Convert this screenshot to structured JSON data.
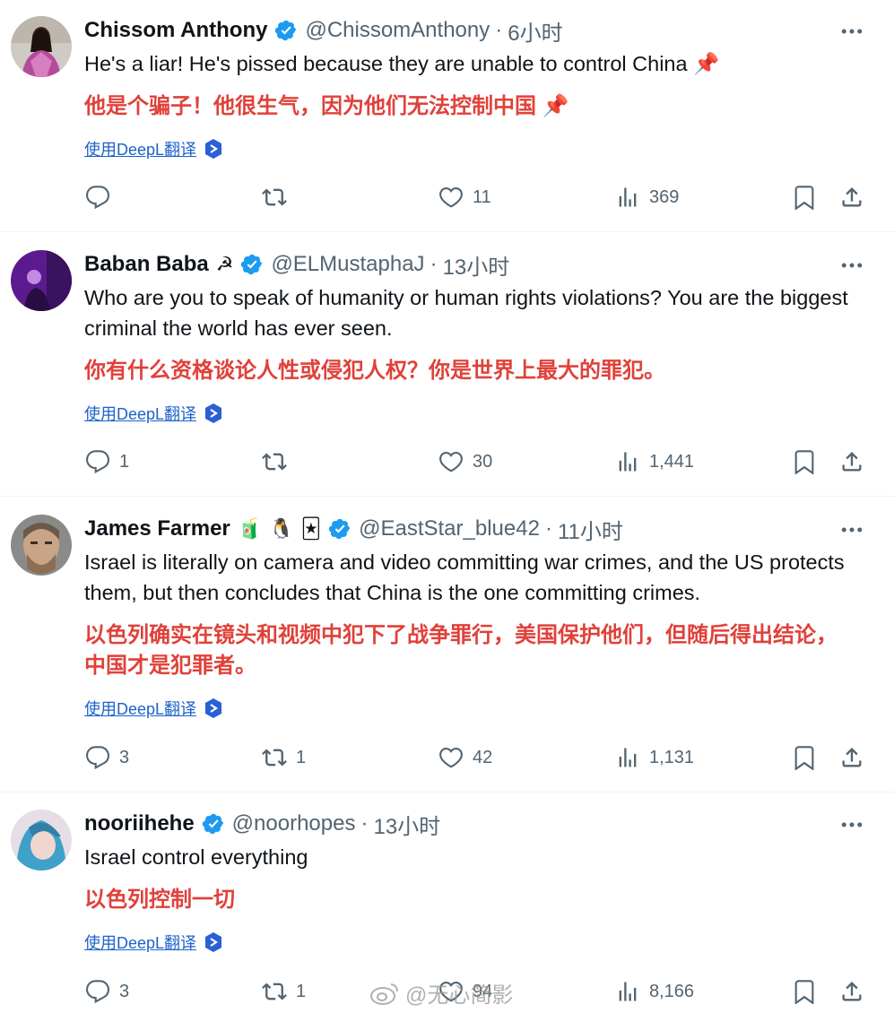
{
  "tweets": [
    {
      "name": "Chissom Anthony",
      "handle": "@ChissomAnthony",
      "dot": "·",
      "time": "6小时",
      "emojis": [],
      "text": "He's a liar! He's pissed because they are unable to control China 📌",
      "translation": "他是个骗子！他很生气，因为他们无法控制中国 📌",
      "translate_label": "使用DeepL翻译",
      "replies": "",
      "reposts": "",
      "likes": "11",
      "views": "369"
    },
    {
      "name": "Baban Baba",
      "handle": "@ELMustaphaJ",
      "dot": "·",
      "time": "13小时",
      "emojis": [
        "☭"
      ],
      "text": "Who are you to speak of humanity or human rights violations? You are the biggest criminal the world has ever seen.",
      "translation": "你有什么资格谈论人性或侵犯人权？你是世界上最大的罪犯。",
      "translate_label": "使用DeepL翻译",
      "replies": "1",
      "reposts": "",
      "likes": "30",
      "views": "1,441"
    },
    {
      "name": "James Farmer",
      "handle": "@EastStar_blue42",
      "dot": "·",
      "time": "11小时",
      "emojis": [
        "🧃",
        "🐧",
        "🃏"
      ],
      "text": "Israel is literally on camera and video committing war crimes, and the US protects them, but then concludes that China is the one committing crimes.",
      "translation": "以色列确实在镜头和视频中犯下了战争罪行，美国保护他们，但随后得出结论，中国才是犯罪者。",
      "translate_label": "使用DeepL翻译",
      "replies": "3",
      "reposts": "1",
      "likes": "42",
      "views": "1,131"
    },
    {
      "name": "nooriihehe",
      "handle": "@noorhopes",
      "dot": "·",
      "time": "13小时",
      "emojis": [],
      "text": "Israel control everything",
      "translation": "以色列控制一切",
      "translate_label": "使用DeepL翻译",
      "replies": "3",
      "reposts": "1",
      "likes": "94",
      "views": "8,166"
    }
  ],
  "watermark": "@无心简影",
  "icons": [
    "more-icon",
    "verified-badge-icon",
    "reply-icon",
    "repost-icon",
    "like-icon",
    "views-icon",
    "bookmark-icon",
    "share-icon",
    "deepl-icon",
    "weibo-icon"
  ],
  "colors": {
    "verified": "#1d9bf0",
    "translation": "#e0413a",
    "link": "#1d62c9",
    "muted": "#536471"
  }
}
